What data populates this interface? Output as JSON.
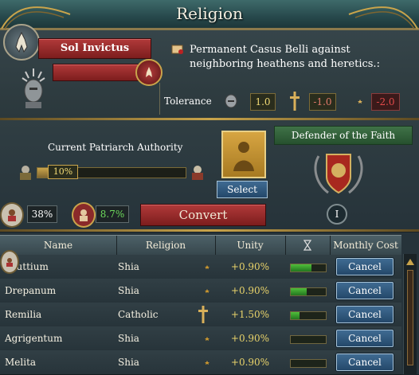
{
  "header": {
    "title": "Religion"
  },
  "religion": {
    "name": "Sol Invictus",
    "casus_belli": "Permanent Casus Belli against neighboring heathens and heretics.:"
  },
  "tolerance": {
    "label": "Tolerance",
    "true_faith": "1.0",
    "heretic": "-1.0",
    "heathen": "-2.0"
  },
  "patriarch": {
    "label": "Current Patriarch Authority",
    "value": "10%",
    "fraction": 0.1,
    "select_label": "Select"
  },
  "defender": {
    "label": "Defender of the Faith",
    "level": "I"
  },
  "stats": {
    "unity_value": "38%",
    "conversion_value": "8.7%",
    "convert_label": "Convert"
  },
  "table": {
    "headers": [
      "Name",
      "Religion",
      "Unity",
      "",
      "Monthly Cost"
    ],
    "rows": [
      {
        "name": "Bruttium",
        "religion": "Shia",
        "religion_icon": "crescent-icon",
        "unity": "+0.90%",
        "bar": 0.6,
        "cancel": "Cancel"
      },
      {
        "name": "Drepanum",
        "religion": "Shia",
        "religion_icon": "crescent-icon",
        "unity": "+0.90%",
        "bar": 0.45,
        "cancel": "Cancel"
      },
      {
        "name": "Remilia",
        "religion": "Catholic",
        "religion_icon": "cross-icon",
        "unity": "+1.50%",
        "bar": 0.25,
        "cancel": "Cancel"
      },
      {
        "name": "Agrigentum",
        "religion": "Shia",
        "religion_icon": "crescent-icon",
        "unity": "+0.90%",
        "bar": 0.0,
        "cancel": "Cancel"
      },
      {
        "name": "Melita",
        "religion": "Shia",
        "religion_icon": "crescent-icon",
        "unity": "+0.90%",
        "bar": 0.0,
        "cancel": "Cancel"
      }
    ]
  },
  "colors": {
    "gold": "#c9a44b",
    "red_banner": "#9b2b2b",
    "green_bar": "#3aa82c",
    "panel": "#2b383c"
  }
}
